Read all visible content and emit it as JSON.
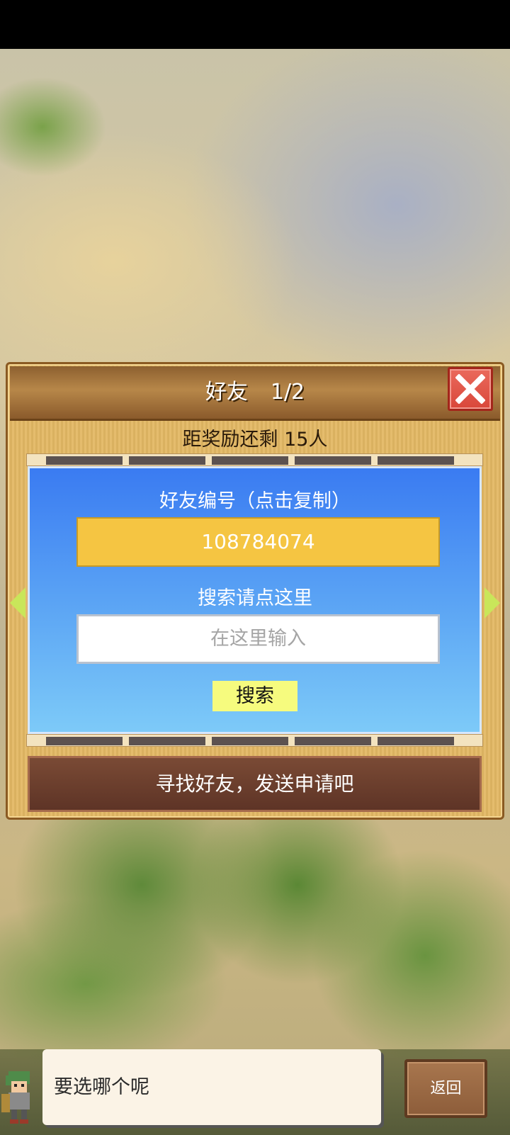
{
  "panel": {
    "title": "好友",
    "page": "1/2",
    "reward_text": "距奖励还剩 15人",
    "friend_id_label": "好友编号（点击复制）",
    "friend_id": "108784074",
    "search_label": "搜索请点这里",
    "search_placeholder": "在这里输入",
    "search_button": "搜索",
    "find_friend_button": "寻找好友，发送申请吧"
  },
  "dialog": {
    "message": "要选哪个呢",
    "back_button": "返回"
  },
  "icons": {
    "close": "close-icon",
    "prev": "arrow-left-icon",
    "next": "arrow-right-icon",
    "avatar": "character-avatar"
  },
  "colors": {
    "accent_close": "#d9473a",
    "id_box": "#f5c542",
    "search_button": "#f6fb7e",
    "arrows": "#c9e65a"
  }
}
